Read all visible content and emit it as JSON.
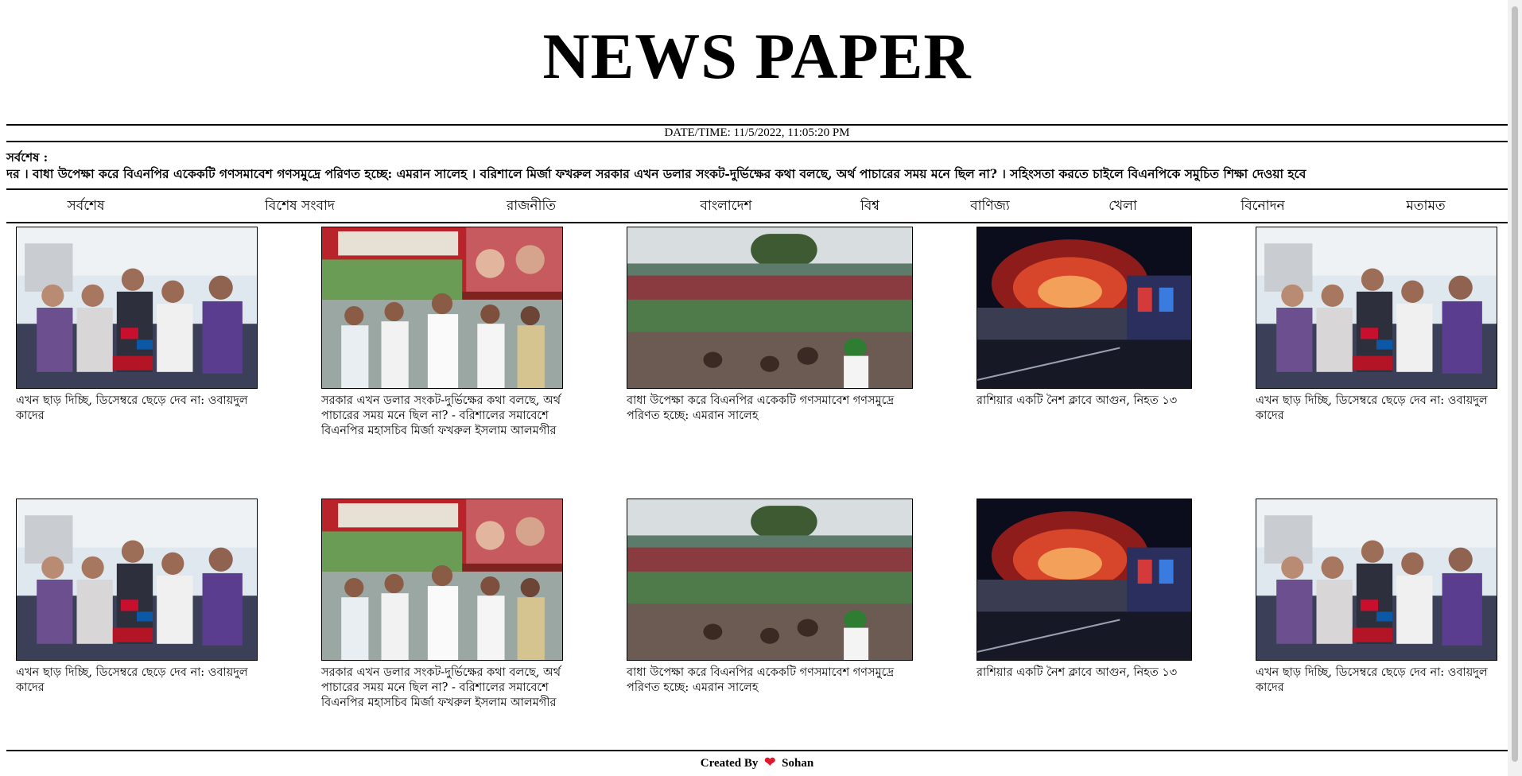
{
  "header": {
    "title": "NEWS PAPER",
    "datetime_label": "DATE/TIME:",
    "datetime_value": "11/5/2022, 11:05:20 PM"
  },
  "breaking": {
    "label": "সর্বশেষ :",
    "ticker": "দর । বাধা উপেক্ষা করে বিএনপির একেকটি গণসমাবেশ গণসমুদ্রে পরিণত হচ্ছে: এমরান সালেহ । বরিশালে মির্জা ফখরুল সরকার এখন ডলার সংকট-দুর্ভিক্ষের কথা বলছে, অর্থ পাচারের সময় মনে ছিল না? । সহিংসতা করতে চাইলে বিএনপিকে সমুচিত শিক্ষা দেওয়া হবে"
  },
  "nav": {
    "items": [
      "সর্বশেষ",
      "বিশেষ সংবাদ",
      "রাজনীতি",
      "বাংলাদেশ",
      "বিশ্ব",
      "বাণিজ্য",
      "খেলা",
      "বিনোদন",
      "মতামত"
    ]
  },
  "news": {
    "row1": [
      {
        "caption": "এখন ছাড় দিচ্ছি, ডিসেম্বরে ছেড়ে দেব না: ওবায়দুল কাদের",
        "image": "rally-leaders-photo"
      },
      {
        "caption": "সরকার এখন ডলার সংকট-দুর্ভিক্ষের কথা বলছে, অর্থ পাচারের সময় মনে ছিল না? - বরিশালের সমাবেশে বিএনপির মহাসচিব মির্জা ফখরুল ইসলাম আলমগীর",
        "image": "bnp-rally-stage-photo"
      },
      {
        "caption": "বাধা উপেক্ষা করে বিএনপির একেকটি গণসমাবেশ গণসমুদ্রে পরিণত হচ্ছে: এমরান সালেহ",
        "image": "crowd-photo"
      },
      {
        "caption": "রাশিয়ার একটি নৈশ ক্লাবে আগুন, নিহত ১৩",
        "image": "fire-photo"
      },
      {
        "caption": "এখন ছাড় দিচ্ছি, ডিসেম্বরে ছেড়ে দেব না: ওবায়দুল কাদের",
        "image": "rally-leaders-photo"
      }
    ],
    "row2": [
      {
        "caption": "এখন ছাড় দিচ্ছি, ডিসেম্বরে ছেড়ে দেব না: ওবায়দুল কাদের",
        "image": "rally-leaders-photo"
      },
      {
        "caption": "সরকার এখন ডলার সংকট-দুর্ভিক্ষের কথা বলছে, অর্থ পাচারের সময় মনে ছিল না? - বরিশালের সমাবেশে বিএনপির মহাসচিব মির্জা ফখরুল ইসলাম আলমগীর",
        "image": "bnp-rally-stage-photo"
      },
      {
        "caption": "বাধা উপেক্ষা করে বিএনপির একেকটি গণসমাবেশ গণসমুদ্রে পরিণত হচ্ছে: এমরান সালেহ",
        "image": "crowd-photo"
      },
      {
        "caption": "রাশিয়ার একটি নৈশ ক্লাবে আগুন, নিহত ১৩",
        "image": "fire-photo"
      },
      {
        "caption": "এখন ছাড় দিচ্ছি, ডিসেম্বরে ছেড়ে দেব না: ওবায়দুল কাদের",
        "image": "rally-leaders-photo"
      }
    ]
  },
  "footer": {
    "created_by": "Created By",
    "author": "Sohan",
    "heart_icon": "heart-icon"
  },
  "colors": {
    "heart": "#e0182d",
    "rule": "#000000",
    "background": "#ffffff"
  }
}
